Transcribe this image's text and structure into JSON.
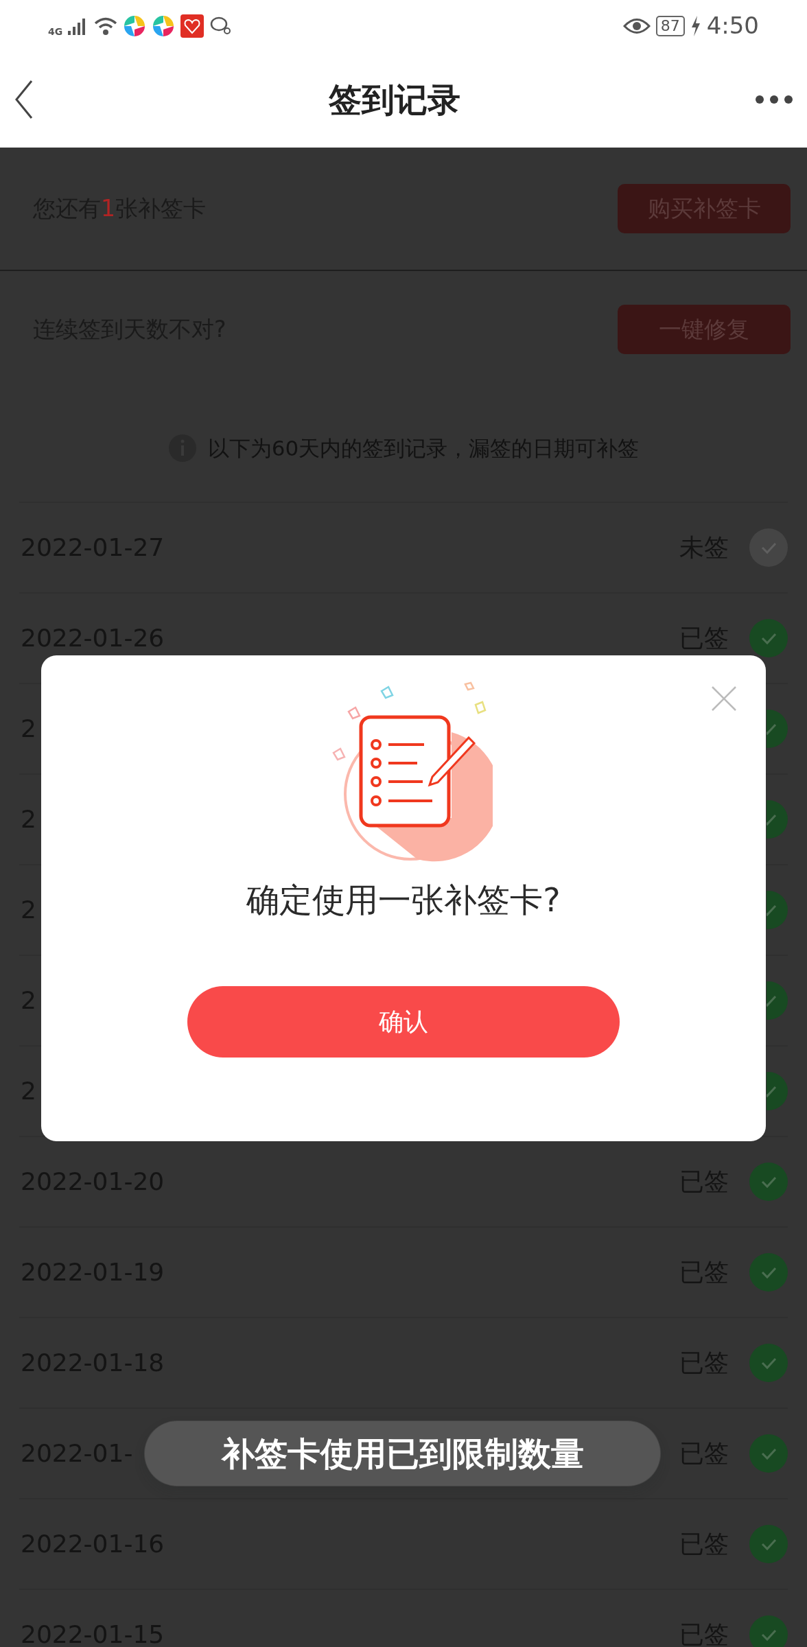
{
  "status_bar": {
    "network": "4G",
    "battery": "87",
    "time": "4:50"
  },
  "header": {
    "title": "签到记录"
  },
  "card_notice": {
    "before": "您还有",
    "count": "1",
    "after": "张补签卡",
    "button": "购买补签卡"
  },
  "repair": {
    "text": "连续签到天数不对?",
    "button": "一键修复"
  },
  "info": "以下为60天内的签到记录，漏签的日期可补签",
  "records": [
    {
      "date": "2022-01-27",
      "status": "未签",
      "signed": false
    },
    {
      "date": "2022-01-26",
      "status": "已签",
      "signed": true
    },
    {
      "date": "2",
      "signed": true
    },
    {
      "date": "2",
      "signed": true
    },
    {
      "date": "2",
      "signed": true
    },
    {
      "date": "2",
      "signed": true
    },
    {
      "date": "2",
      "signed": true
    },
    {
      "date": "2022-01-20",
      "status": "已签",
      "signed": true
    },
    {
      "date": "2022-01-19",
      "status": "已签",
      "signed": true
    },
    {
      "date": "2022-01-18",
      "status": "已签",
      "signed": true
    },
    {
      "date": "2022-01-",
      "status": "已签",
      "signed": true
    },
    {
      "date": "2022-01-16",
      "status": "已签",
      "signed": true
    },
    {
      "date": "2022-01-15",
      "status": "已签",
      "signed": true
    }
  ],
  "dialog": {
    "question": "确定使用一张补签卡?",
    "confirm": "确认"
  },
  "toast": "补签卡使用已到限制数量"
}
